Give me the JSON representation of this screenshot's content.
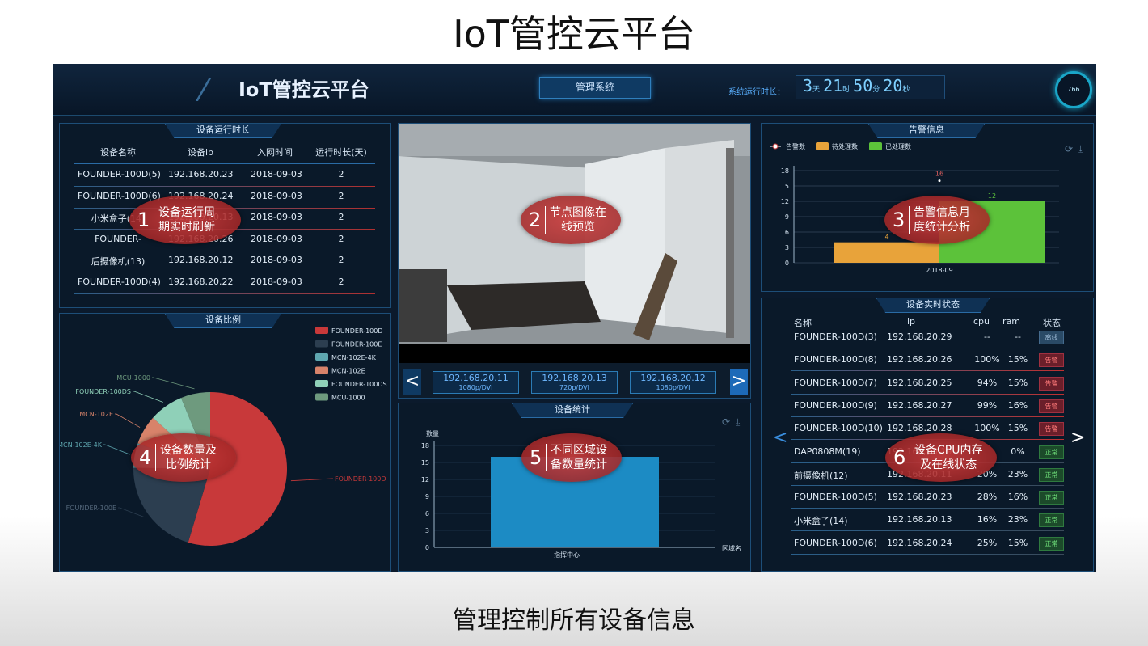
{
  "slide": {
    "title": "IoT管控云平台",
    "caption": "管理控制所有设备信息"
  },
  "header": {
    "title": "IoT管控云平台",
    "mgmt_button": "管理系统",
    "runtime_label": "系统运行时长：",
    "runtime": {
      "days": "3",
      "hours": "21",
      "minutes": "50",
      "seconds": "20",
      "day_unit": "天",
      "hour_unit": "时",
      "minute_unit": "分",
      "second_unit": "秒"
    },
    "gauge_value": "766"
  },
  "colors": {
    "bg": "#0b1a2c",
    "accent": "#2a6ba5",
    "alarm": "#b03030",
    "bubble": "#c83c3c"
  },
  "runtime_panel": {
    "title": "设备运行时长",
    "columns": [
      "设备名称",
      "设备ip",
      "入网时间",
      "运行时长(天)"
    ],
    "rows": [
      [
        "FOUNDER-100D(5)",
        "192.168.20.23",
        "2018-09-03",
        "2"
      ],
      [
        "FOUNDER-100D(6)",
        "192.168.20.24",
        "2018-09-03",
        "2"
      ],
      [
        "小米盒子(14)",
        "192.168.20.13",
        "2018-09-03",
        "2"
      ],
      [
        "FOUNDER-",
        "192.168.20.26",
        "2018-09-03",
        "2"
      ],
      [
        "后摄像机(13)",
        "192.168.20.12",
        "2018-09-03",
        "2"
      ],
      [
        "FOUNDER-100D(4)",
        "192.168.20.22",
        "2018-09-03",
        "2"
      ]
    ]
  },
  "video_panel": {
    "ip_buttons": [
      {
        "ip": "192.168.20.11",
        "res": "1080p/DVI"
      },
      {
        "ip": "192.168.20.13",
        "res": "720p/DVI"
      },
      {
        "ip": "192.168.20.12",
        "res": "1080p/DVI"
      }
    ],
    "prev": "<",
    "next": ">"
  },
  "alarm_panel": {
    "title": "告警信息"
  },
  "ratio_panel": {
    "title": "设备比例"
  },
  "stats_panel": {
    "title": "设备统计"
  },
  "status_panel": {
    "title": "设备实时状态",
    "columns": [
      "名称",
      "ip",
      "cpu",
      "ram",
      "状态"
    ],
    "rows": [
      {
        "name": "FOUNDER-100D(3)",
        "ip": "192.168.20.29",
        "cpu": "--",
        "ram": "--",
        "status": "离线",
        "kind": "offline"
      },
      {
        "name": "FOUNDER-100D(8)",
        "ip": "192.168.20.26",
        "cpu": "100%",
        "ram": "15%",
        "status": "告警",
        "kind": "alarm"
      },
      {
        "name": "FOUNDER-100D(7)",
        "ip": "192.168.20.25",
        "cpu": "94%",
        "ram": "15%",
        "status": "告警",
        "kind": "alarm"
      },
      {
        "name": "FOUNDER-100D(9)",
        "ip": "192.168.20.27",
        "cpu": "99%",
        "ram": "16%",
        "status": "告警",
        "kind": "alarm"
      },
      {
        "name": "FOUNDER-100D(10)",
        "ip": "192.168.20.28",
        "cpu": "100%",
        "ram": "15%",
        "status": "告警",
        "kind": "alarm"
      },
      {
        "name": "DAP0808M(19)",
        "ip": "192.168.20.19",
        "cpu": "",
        "ram": "0%",
        "status": "正常",
        "kind": "normal"
      },
      {
        "name": "前摄像机(12)",
        "ip": "192.168.20.11",
        "cpu": "20%",
        "ram": "23%",
        "status": "正常",
        "kind": "normal"
      },
      {
        "name": "FOUNDER-100D(5)",
        "ip": "192.168.20.23",
        "cpu": "28%",
        "ram": "16%",
        "status": "正常",
        "kind": "normal"
      },
      {
        "name": "小米盒子(14)",
        "ip": "192.168.20.13",
        "cpu": "16%",
        "ram": "23%",
        "status": "正常",
        "kind": "normal"
      },
      {
        "name": "FOUNDER-100D(6)",
        "ip": "192.168.20.24",
        "cpu": "25%",
        "ram": "15%",
        "status": "正常",
        "kind": "normal"
      }
    ],
    "prev": "<",
    "next": ">"
  },
  "bubbles": [
    {
      "num": "1",
      "text": "设备运行周\n期实时刷新"
    },
    {
      "num": "2",
      "text": "节点图像在\n线预览"
    },
    {
      "num": "3",
      "text": "告警信息月\n度统计分析"
    },
    {
      "num": "4",
      "text": "设备数量及\n比例统计"
    },
    {
      "num": "5",
      "text": "不同区域设\n备数量统计"
    },
    {
      "num": "6",
      "text": "设备CPU内存\n及在线状态"
    }
  ],
  "chart_data": [
    {
      "type": "bar",
      "title": "告警信息",
      "legend": [
        "告警数",
        "待处理数",
        "已处理数"
      ],
      "categories": [
        "2018-09"
      ],
      "series": [
        {
          "name": "告警数",
          "values": [
            16
          ],
          "color": "#ffffff",
          "kind": "point"
        },
        {
          "name": "待处理数",
          "values": [
            4
          ],
          "color": "#e8a33a"
        },
        {
          "name": "已处理数",
          "values": [
            12
          ],
          "color": "#5cc23a"
        }
      ],
      "ylim": [
        0,
        18
      ],
      "yticks": [
        0,
        3,
        6,
        9,
        12,
        15,
        18
      ],
      "grid": true,
      "legend_position": "top-left"
    },
    {
      "type": "pie",
      "title": "设备比例",
      "labels": [
        "FOUNDER-100D",
        "FOUNDER-100E",
        "MCN-102E-4K",
        "MCN-102E",
        "FOUNDER-100DS",
        "MCU-1000"
      ],
      "values": [
        53,
        20,
        5,
        6,
        7,
        6
      ],
      "colors": [
        "#c8393a",
        "#2c3e50",
        "#5fa7b0",
        "#d8836a",
        "#8fd0b8",
        "#6e9a7e"
      ],
      "legend_position": "top-right"
    },
    {
      "type": "bar",
      "title": "设备统计",
      "categories": [
        "指挥中心"
      ],
      "values": [
        16
      ],
      "xlabel": "区域名",
      "ylabel": "数量",
      "ylim": [
        0,
        18
      ],
      "yticks": [
        0,
        3,
        6,
        9,
        12,
        15,
        18
      ],
      "color": "#1c8bc4",
      "grid": true
    }
  ]
}
